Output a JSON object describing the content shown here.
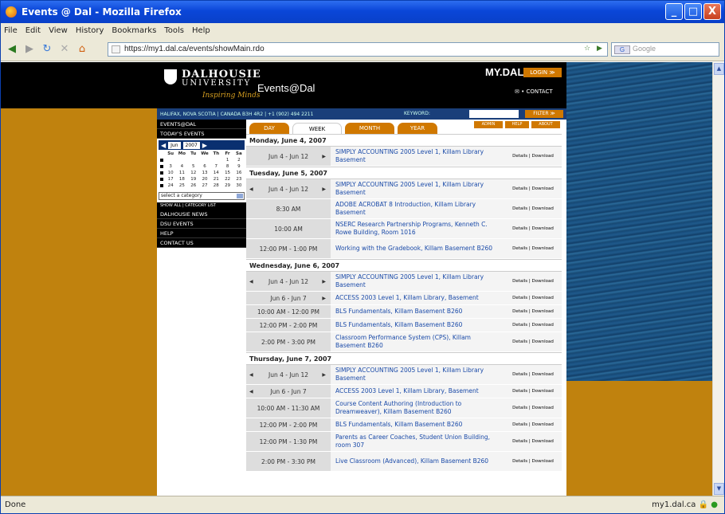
{
  "window": {
    "title": "Events @ Dal - Mozilla Firefox",
    "min": "_",
    "max": "□",
    "close": "X"
  },
  "menu": [
    "File",
    "Edit",
    "View",
    "History",
    "Bookmarks",
    "Tools",
    "Help"
  ],
  "nav": {
    "url": "https://my1.dal.ca/events/showMain.rdo",
    "search_placeholder": "Google",
    "search_engine": "G"
  },
  "status": {
    "text": "Done",
    "host": "my1.dal.ca"
  },
  "header": {
    "uni1": "DALHOUSIE",
    "uni2": "UNIVERSITY",
    "tagline": "Inspiring Minds",
    "site_title": "Events@Dal",
    "mydal": "MY.DAL",
    "login": "LOGIN ≫",
    "contact": "✉ • CONTACT"
  },
  "infobar": {
    "address": "HALIFAX, NOVA SCOTIA | CANADA B3H 4R2 | +1 (902) 494 2211",
    "keyword": "KEYWORD:",
    "filter": "FILTER ≫"
  },
  "sidebar": {
    "events": "EVENTS@DAL",
    "today": "TODAY'S EVENTS",
    "month": "Jun",
    "year": "2007",
    "days": [
      "Su",
      "Mo",
      "Tu",
      "We",
      "Th",
      "Fr",
      "Sa"
    ],
    "weeks": [
      [
        "",
        "",
        "",
        "",
        "",
        "1",
        "2"
      ],
      [
        "3",
        "4",
        "5",
        "6",
        "7",
        "8",
        "9"
      ],
      [
        "10",
        "11",
        "12",
        "13",
        "14",
        "15",
        "16"
      ],
      [
        "17",
        "18",
        "19",
        "20",
        "21",
        "22",
        "23"
      ],
      [
        "24",
        "25",
        "26",
        "27",
        "28",
        "29",
        "30"
      ]
    ],
    "category": "select a category",
    "catlinks": "SHOW ALL | CATEGORY LIST",
    "links": [
      "DALHOUSIE NEWS",
      "DSU EVENTS",
      "HELP",
      "CONTACT US"
    ]
  },
  "tabs": {
    "day": "DAY",
    "week": "WEEK",
    "month": "MONTH",
    "year": "YEAR",
    "b1": "ADMIN",
    "b2": "HELP",
    "b3": "ABOUT"
  },
  "days": [
    {
      "heading": "Monday, June 4, 2007",
      "events": [
        {
          "time": "Jun 4 - Jun 12",
          "arrows": "right",
          "title": "SIMPLY ACCOUNTING 2005 Level 1, Killam Library Basement",
          "details": "Details | Download"
        }
      ]
    },
    {
      "heading": "Tuesday, June 5, 2007",
      "events": [
        {
          "time": "Jun 4 - Jun 12",
          "arrows": "both",
          "title": "SIMPLY ACCOUNTING 2005 Level 1, Killam Library Basement",
          "details": "Details | Download"
        },
        {
          "time": "8:30 AM",
          "arrows": "none",
          "title": "ADOBE ACROBAT 8 Introduction, Killam Library Basement",
          "details": "Details | Download"
        },
        {
          "time": "10:00 AM",
          "arrows": "none",
          "title": "NSERC Research Partnership Programs, Kenneth C. Rowe Building, Room 1016",
          "details": "Details | Download"
        },
        {
          "time": "12:00 PM - 1:00 PM",
          "arrows": "none",
          "title": "Working with the Gradebook, Killam Basement B260",
          "details": "Details | Download"
        }
      ]
    },
    {
      "heading": "Wednesday, June 6, 2007",
      "events": [
        {
          "time": "Jun 4 - Jun 12",
          "arrows": "both",
          "title": "SIMPLY ACCOUNTING 2005 Level 1, Killam Library Basement",
          "details": "Details | Download"
        },
        {
          "time": "Jun 6 - Jun 7",
          "arrows": "right",
          "title": "ACCESS 2003 Level 1, Killam Library, Basement",
          "details": "Details | Download"
        },
        {
          "time": "10:00 AM - 12:00 PM",
          "arrows": "none",
          "title": "BLS Fundamentals, Killam Basement B260",
          "details": "Details | Download"
        },
        {
          "time": "12:00 PM - 2:00 PM",
          "arrows": "none",
          "title": "BLS Fundamentals, Killam Basement B260",
          "details": "Details | Download"
        },
        {
          "time": "2:00 PM - 3:00 PM",
          "arrows": "none",
          "title": "Classroom Performance System (CPS), Killam Basement B260",
          "details": "Details | Download"
        }
      ]
    },
    {
      "heading": "Thursday, June 7, 2007",
      "events": [
        {
          "time": "Jun 4 - Jun 12",
          "arrows": "both",
          "title": "SIMPLY ACCOUNTING 2005 Level 1, Killam Library Basement",
          "details": "Details | Download"
        },
        {
          "time": "Jun 6 - Jun 7",
          "arrows": "left",
          "title": "ACCESS 2003 Level 1, Killam Library, Basement",
          "details": "Details | Download"
        },
        {
          "time": "10:00 AM - 11:30 AM",
          "arrows": "none",
          "title": "Course Content Authoring (Introduction to Dreamweaver), Killam Basement B260",
          "details": "Details | Download"
        },
        {
          "time": "12:00 PM - 2:00 PM",
          "arrows": "none",
          "title": "BLS Fundamentals, Killam Basement B260",
          "details": "Details | Download"
        },
        {
          "time": "12:00 PM - 1:30 PM",
          "arrows": "none",
          "title": "Parents as Career Coaches, Student Union Building, room 307",
          "details": "Details | Download"
        },
        {
          "time": "2:00 PM - 3:30 PM",
          "arrows": "none",
          "title": "Live Classroom (Advanced), Killam Basement B260",
          "details": "Details | Download"
        }
      ]
    }
  ]
}
